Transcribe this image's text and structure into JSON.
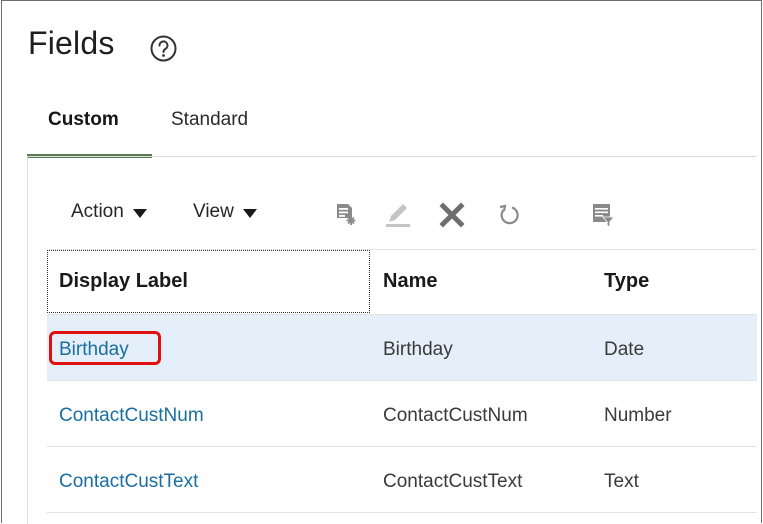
{
  "header": {
    "title": "Fields"
  },
  "tabs": [
    {
      "label": "Custom",
      "active": true
    },
    {
      "label": "Standard",
      "active": false
    }
  ],
  "toolbar": {
    "action_label": "Action",
    "view_label": "View",
    "icons": [
      "add-row-icon",
      "edit-icon",
      "delete-icon",
      "refresh-icon",
      "export-icon"
    ]
  },
  "table": {
    "columns": [
      "Display Label",
      "Name",
      "Type"
    ],
    "rows": [
      {
        "display_label": "Birthday",
        "name": "Birthday",
        "type": "Date",
        "selected": true
      },
      {
        "display_label": "ContactCustNum",
        "name": "ContactCustNum",
        "type": "Number",
        "selected": false
      },
      {
        "display_label": "ContactCustText",
        "name": "ContactCustText",
        "type": "Text",
        "selected": false
      }
    ]
  },
  "colors": {
    "tab_underline": "#5c7a52",
    "link": "#1a6ea0",
    "selected_row": "#e4eff9",
    "highlight": "#e01010"
  }
}
